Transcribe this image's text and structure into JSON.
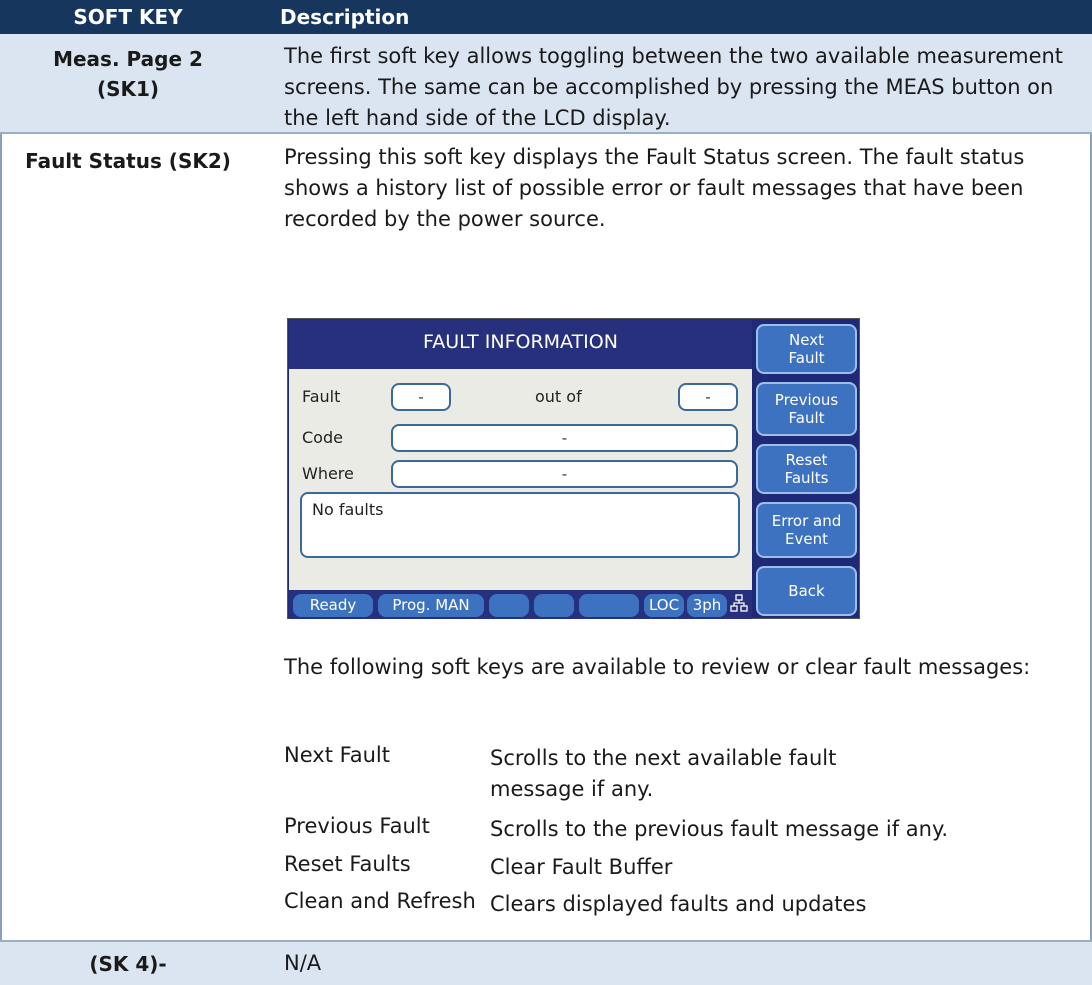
{
  "header": {
    "col_key": "SOFT KEY",
    "col_desc": "Description"
  },
  "rows": [
    {
      "key_line1": "Meas. Page 2",
      "key_line2": "(SK1)",
      "desc": "The first soft key allows toggling between the two available measurement screens. The same can be accomplished by pressing the MEAS button on the left hand side of the LCD display."
    },
    {
      "key": "Fault Status (SK2)",
      "desc": "Pressing this soft key displays the Fault Status screen. The fault status shows a history list of possible error or fault messages that have been recorded by the power source.",
      "after_text": "The following soft keys are available to review or clear fault messages:",
      "softkeys": [
        {
          "name": "Next Fault",
          "desc": "Scrolls to the next available fault message if any."
        },
        {
          "name": "Previous Fault",
          "desc": "Scrolls to the previous fault message if any."
        },
        {
          "name": "Reset Faults",
          "desc": "Clear Fault Buffer"
        },
        {
          "name": "Clean and Refresh",
          "desc": "Clears displayed faults and updates"
        }
      ]
    },
    {
      "key": "(SK 4)-",
      "desc": "N/A"
    }
  ],
  "lcd": {
    "title": "FAULT INFORMATION",
    "fault_label": "Fault",
    "fault_value": "-",
    "out_of_label": "out of",
    "out_of_value": "-",
    "code_label": "Code",
    "code_value": "-",
    "where_label": "Where",
    "where_value": "-",
    "message": "No faults",
    "status": [
      "Ready",
      "Prog. MAN",
      "",
      "",
      "",
      "LOC",
      "3ph"
    ],
    "side_buttons": [
      {
        "line1": "Next",
        "line2": "Fault"
      },
      {
        "line1": "Previous",
        "line2": "Fault"
      },
      {
        "line1": "Reset",
        "line2": "Faults"
      },
      {
        "line1": "Error and",
        "line2": "Event"
      },
      {
        "line1": "Back",
        "line2": ""
      }
    ],
    "colors": {
      "title_bar": "#26307c",
      "button": "#3d72c0",
      "panel": "#ebebe6"
    }
  },
  "colors": {
    "header_bg": "#17365d",
    "shaded_row": "#dbe5f1"
  }
}
